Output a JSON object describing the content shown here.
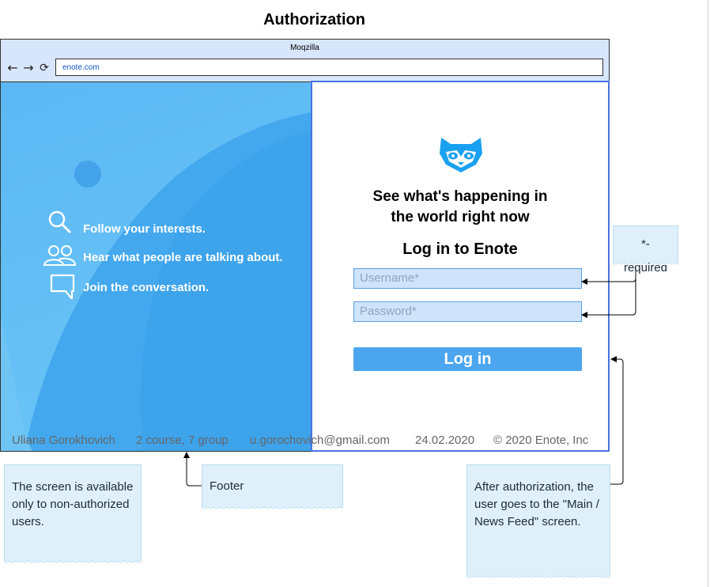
{
  "title": "Authorization",
  "browser": {
    "name": "Moqzilla",
    "url": "enote.com",
    "nav_icons": [
      "back-arrow-icon",
      "forward-arrow-icon",
      "reload-icon"
    ]
  },
  "hero": {
    "features": [
      {
        "icon": "search-icon",
        "text": "Follow your interests."
      },
      {
        "icon": "people-icon",
        "text": "Hear what people are talking about."
      },
      {
        "icon": "chat-bubble-icon",
        "text": "Join the conversation."
      }
    ],
    "colors": {
      "bg": "#5cb8f4",
      "dark": "#3ea2ec",
      "light": "#7bd0f7"
    }
  },
  "login": {
    "logo": "raccoon-logo",
    "headline_line1": "See what's happening in",
    "headline_line2": "the world right now",
    "title": "Log in to Enote",
    "username_placeholder": "Username*",
    "password_placeholder": "Password*",
    "button_label": "Log in",
    "accent": "#4ba6ef",
    "border": "#4a72e0"
  },
  "footer": {
    "author": "Uliana Gorokhovich",
    "group": "2 course, 7 group",
    "email": "u.gorochovich@gmail.com",
    "date": "24.02.2020",
    "copyright": "© 2020 Enote, Inc"
  },
  "notes": {
    "required": "*-required",
    "footer": "Footer",
    "availability": "The screen is available only to non-authorized users.",
    "after_auth": "After authorization, the user goes to the \"Main / News Feed\" screen."
  }
}
